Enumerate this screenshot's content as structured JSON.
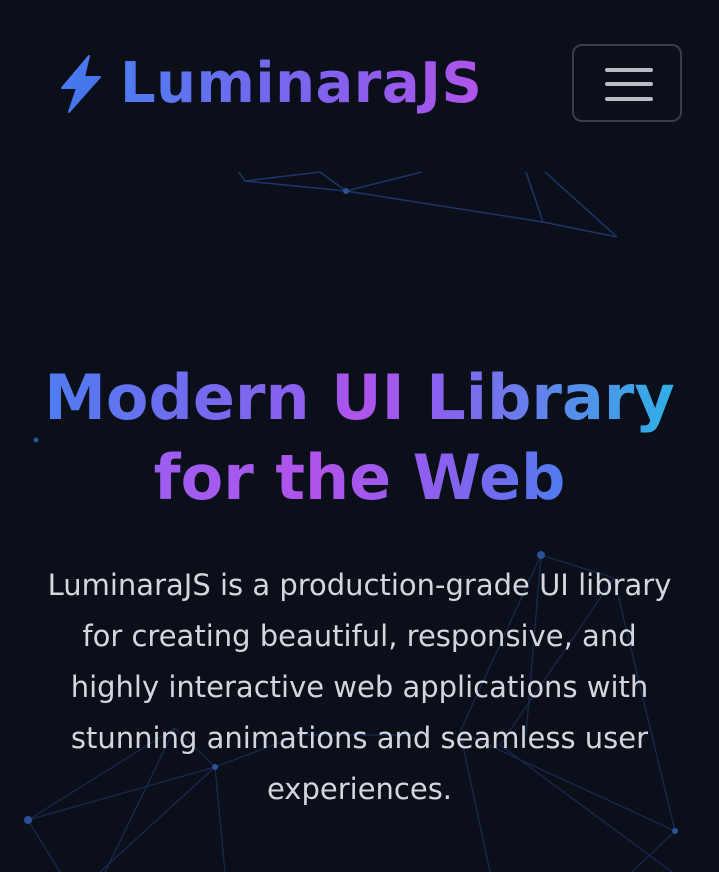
{
  "header": {
    "brand_name": "LuminaraJS",
    "brand_icon": "lightning-bolt-icon",
    "menu_icon": "hamburger-menu-icon"
  },
  "hero": {
    "title_line1": "Modern UI Library",
    "title_line2": "for the Web",
    "description": "LuminaraJS is a production-grade UI library for creating beautiful, responsive, and highly interactive web applications with stunning animations and seamless user experiences."
  },
  "colors": {
    "background": "#0b0f1a",
    "accent_blue": "#4f7cf0",
    "accent_purple": "#b153ea",
    "accent_cyan": "#2fb0e6",
    "text": "#d4d6dc"
  }
}
